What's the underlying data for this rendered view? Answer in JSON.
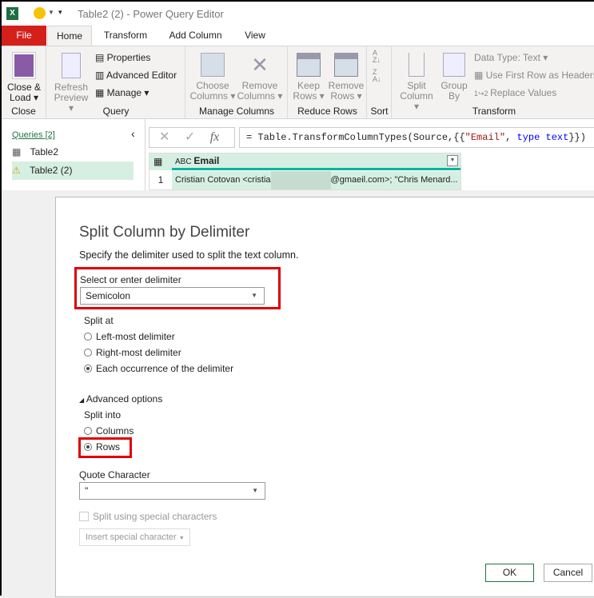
{
  "window": {
    "title": "Table2 (2) - Power Query Editor"
  },
  "tabs": [
    "File",
    "Home",
    "Transform",
    "Add Column",
    "View"
  ],
  "ribbon": {
    "close": {
      "button": "Close &",
      "button2": "Load",
      "group": "Close"
    },
    "query": {
      "refresh": "Refresh",
      "refresh2": "Preview",
      "properties": "Properties",
      "advanced_editor": "Advanced Editor",
      "manage": "Manage",
      "group": "Query"
    },
    "manage_columns": {
      "choose": "Choose",
      "choose2": "Columns",
      "remove": "Remove",
      "remove2": "Columns",
      "group": "Manage Columns"
    },
    "reduce_rows": {
      "keep": "Keep",
      "keep2": "Rows",
      "remove": "Remove",
      "remove2": "Rows",
      "group": "Reduce Rows"
    },
    "sort": {
      "group": "Sort"
    },
    "transform": {
      "split": "Split",
      "split2": "Column",
      "group_by": "Group",
      "group_by2": "By",
      "data_type": "Data Type: Text",
      "first_row": "Use First Row as Headers",
      "replace": "Replace Values",
      "group": "Transform"
    }
  },
  "queries": {
    "header": "Queries [2]",
    "items": [
      "Table2",
      "Table2 (2)"
    ]
  },
  "formula": {
    "prefix": "= Table.TransformColumnTypes(Source,{{",
    "string": "\"Email\"",
    "mid": ", ",
    "kw": "type",
    "type": " text",
    "suffix": "}})"
  },
  "table": {
    "column": "Email",
    "rows": [
      {
        "num": "1",
        "start": "Cristian Cotovan <cristia",
        "end": "@gmaeil.com>; \"Chris Menard..."
      }
    ]
  },
  "dialog": {
    "title": "Split Column by Delimiter",
    "subtitle": "Specify the delimiter used to split the text column.",
    "delimiter_label": "Select or enter delimiter",
    "delimiter_value": "Semicolon",
    "split_at_label": "Split at",
    "split_at_options": [
      "Left-most delimiter",
      "Right-most delimiter",
      "Each occurrence of the delimiter"
    ],
    "split_at_selected": 2,
    "advanced": "Advanced options",
    "split_into_label": "Split into",
    "split_into_options": [
      "Columns",
      "Rows"
    ],
    "split_into_selected": 1,
    "quote_label": "Quote Character",
    "quote_value": "\"",
    "special_chars": "Split using special characters",
    "insert_special": "Insert special character",
    "ok": "OK",
    "cancel": "Cancel"
  },
  "colors": {
    "file_tab": "#d4201b",
    "highlight": "#e00000",
    "accent": "#00b4a0",
    "selected_query": "#d6efe3",
    "ok_border": "#217346"
  }
}
